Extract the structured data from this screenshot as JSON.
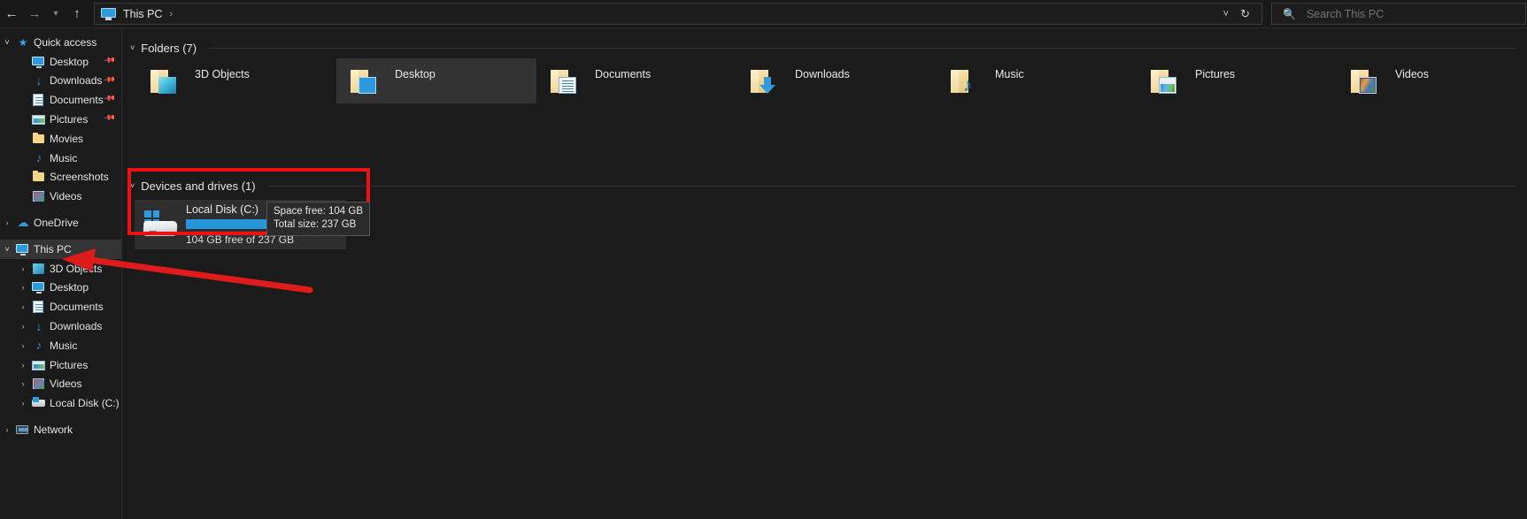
{
  "window": {
    "title": "This PC"
  },
  "toolbar": {
    "back_icon": "arrow-left-icon",
    "forward_icon": "arrow-right-icon",
    "recent_icon": "chevron-down-icon",
    "up_icon": "arrow-up-icon",
    "breadcrumb": [
      "This PC"
    ],
    "breadcrumb_separator": "›",
    "address_chevron": "˅",
    "refresh_icon": "↻",
    "search_placeholder": "Search This PC",
    "search_value": ""
  },
  "sidebar": {
    "items": [
      {
        "label": "Quick access",
        "icon": "star-icon",
        "expander": "open",
        "level": 1,
        "pinned": false,
        "selected": false
      },
      {
        "label": "Desktop",
        "icon": "monitor-icon",
        "expander": "none",
        "level": 2,
        "pinned": true,
        "selected": false
      },
      {
        "label": "Downloads",
        "icon": "download-icon",
        "expander": "none",
        "level": 2,
        "pinned": true,
        "selected": false
      },
      {
        "label": "Documents",
        "icon": "document-icon",
        "expander": "none",
        "level": 2,
        "pinned": true,
        "selected": false
      },
      {
        "label": "Pictures",
        "icon": "picture-icon",
        "expander": "none",
        "level": 2,
        "pinned": true,
        "selected": false
      },
      {
        "label": "Movies",
        "icon": "folder-icon",
        "expander": "none",
        "level": 2,
        "pinned": false,
        "selected": false
      },
      {
        "label": "Music",
        "icon": "music-icon",
        "expander": "none",
        "level": 2,
        "pinned": false,
        "selected": false
      },
      {
        "label": "Screenshots",
        "icon": "folder-icon",
        "expander": "none",
        "level": 2,
        "pinned": false,
        "selected": false
      },
      {
        "label": "Videos",
        "icon": "video-icon",
        "expander": "none",
        "level": 2,
        "pinned": false,
        "selected": false
      },
      {
        "label": "",
        "icon": "spacer",
        "expander": "none",
        "level": 1,
        "pinned": false,
        "selected": false
      },
      {
        "label": "OneDrive",
        "icon": "cloud-icon",
        "expander": "closed",
        "level": 1,
        "pinned": false,
        "selected": false
      },
      {
        "label": "",
        "icon": "spacer",
        "expander": "none",
        "level": 1,
        "pinned": false,
        "selected": false
      },
      {
        "label": "This PC",
        "icon": "monitor-icon",
        "expander": "open",
        "level": 1,
        "pinned": false,
        "selected": true
      },
      {
        "label": "3D Objects",
        "icon": "cube-icon",
        "expander": "closed",
        "level": 2,
        "pinned": false,
        "selected": false
      },
      {
        "label": "Desktop",
        "icon": "monitor-icon",
        "expander": "closed",
        "level": 2,
        "pinned": false,
        "selected": false
      },
      {
        "label": "Documents",
        "icon": "document-icon",
        "expander": "closed",
        "level": 2,
        "pinned": false,
        "selected": false
      },
      {
        "label": "Downloads",
        "icon": "download-icon",
        "expander": "closed",
        "level": 2,
        "pinned": false,
        "selected": false
      },
      {
        "label": "Music",
        "icon": "music-icon",
        "expander": "closed",
        "level": 2,
        "pinned": false,
        "selected": false
      },
      {
        "label": "Pictures",
        "icon": "picture-icon",
        "expander": "closed",
        "level": 2,
        "pinned": false,
        "selected": false
      },
      {
        "label": "Videos",
        "icon": "video-icon",
        "expander": "closed",
        "level": 2,
        "pinned": false,
        "selected": false
      },
      {
        "label": "Local Disk (C:)",
        "icon": "disk-icon",
        "expander": "closed",
        "level": 2,
        "pinned": false,
        "selected": false
      },
      {
        "label": "",
        "icon": "spacer",
        "expander": "none",
        "level": 1,
        "pinned": false,
        "selected": false
      },
      {
        "label": "Network",
        "icon": "network-icon",
        "expander": "closed",
        "level": 1,
        "pinned": false,
        "selected": false
      }
    ]
  },
  "main": {
    "groups": [
      {
        "title": "Folders (7)",
        "chevron": "˅"
      },
      {
        "title": "Devices and drives (1)",
        "chevron": "˅"
      }
    ],
    "folders": [
      {
        "label": "3D Objects",
        "emblem": "emb-cube",
        "selected": false
      },
      {
        "label": "Desktop",
        "emblem": "emb-desktop",
        "selected": true
      },
      {
        "label": "Documents",
        "emblem": "emb-docs",
        "selected": false
      },
      {
        "label": "Downloads",
        "emblem": "emb-download",
        "selected": false
      },
      {
        "label": "Music",
        "emblem": "emb-music",
        "selected": false,
        "glyph": "♪"
      },
      {
        "label": "Pictures",
        "emblem": "emb-pictures",
        "selected": false
      },
      {
        "label": "Videos",
        "emblem": "emb-videos",
        "selected": false
      }
    ],
    "drive": {
      "name": "Local Disk (C:)",
      "free_text": "104 GB free of 237 GB",
      "used_percent": 56,
      "bar_fill_color": "#2596db",
      "bar_track_color": "#e2e2e2"
    },
    "tooltip": {
      "line1": "Space free: 104 GB",
      "line2": "Total size: 237 GB"
    }
  },
  "annotations": {
    "highlight_box_color": "#ee1111",
    "arrow_color": "#e01b1b",
    "arrow_target": "This PC"
  }
}
